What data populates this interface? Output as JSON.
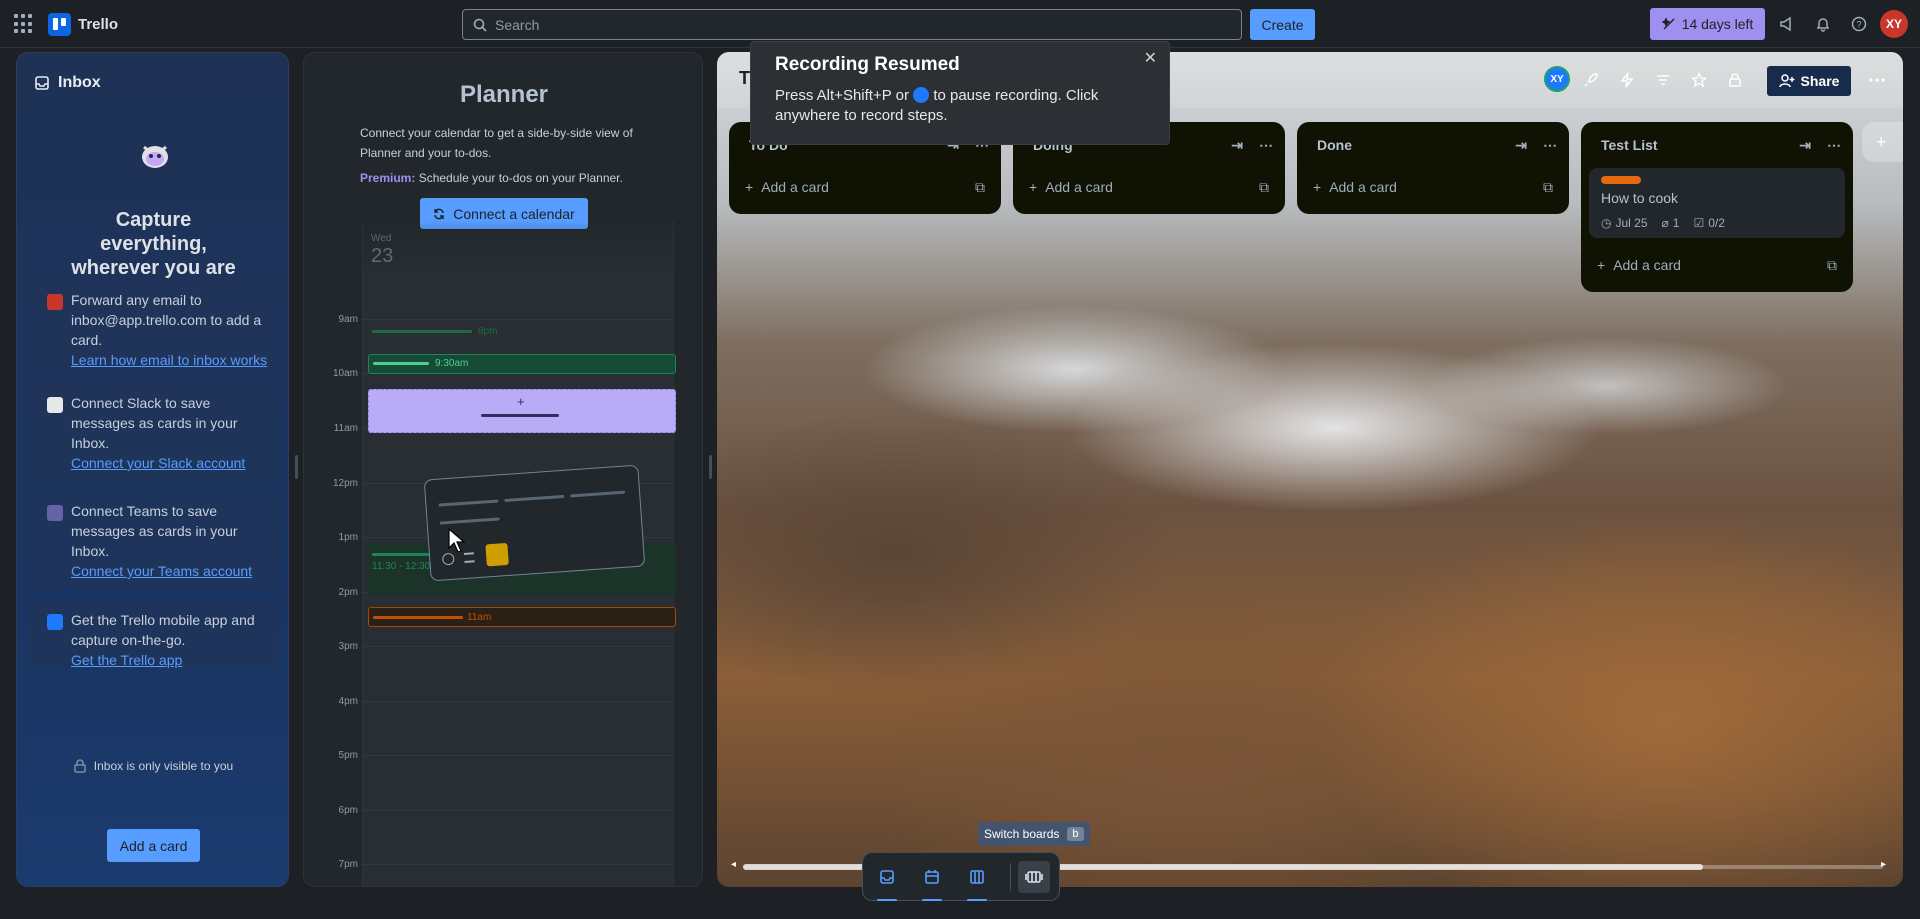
{
  "topbar": {
    "app_name": "Trello",
    "search_placeholder": "Search",
    "create_label": "Create",
    "trial_label": "14 days left",
    "avatar_initials": "XY"
  },
  "inbox": {
    "title": "Inbox",
    "headline": "Capture everything, wherever you are",
    "items": [
      {
        "icon": "email-icon",
        "text": "Forward any email to inbox@app.trello.com to add a card.",
        "link": "Learn how email to inbox works"
      },
      {
        "icon": "slack-icon",
        "text": "Connect Slack to save messages as cards in your Inbox.",
        "link": "Connect your Slack account"
      },
      {
        "icon": "teams-icon",
        "text": "Connect Teams to save messages as cards in your Inbox.",
        "link": "Connect your Teams account"
      },
      {
        "icon": "mobile-icon",
        "text": "Get the Trello mobile app and capture on-the-go.",
        "link": "Get the Trello app"
      }
    ],
    "private_note": "Inbox is only visible to you",
    "add_card_label": "Add a card"
  },
  "planner": {
    "title": "Planner",
    "description": "Connect your calendar to get a side-by-side view of Planner and your to-dos.",
    "premium_label": "Premium:",
    "premium_text": "Schedule your to-dos on your Planner.",
    "connect_label": "Connect a calendar",
    "day": "Wed",
    "date": "23",
    "hours": [
      "9am",
      "10am",
      "11am",
      "12pm",
      "1pm",
      "2pm",
      "3pm",
      "4pm",
      "5pm",
      "6pm",
      "7pm"
    ],
    "events": {
      "ev1_time": "8pm",
      "ev2_time": "9:30am",
      "ev3_time": "11:30 - 12:30pm",
      "ev4_time": "11am"
    }
  },
  "board": {
    "name": "Trello",
    "share_label": "Share",
    "avatar_initials": "XY",
    "lists": [
      {
        "name": "To Do",
        "add_label": "Add a card"
      },
      {
        "name": "Doing",
        "add_label": "Add a card"
      },
      {
        "name": "Done",
        "add_label": "Add a card"
      },
      {
        "name": "Test List",
        "add_label": "Add a card",
        "card": {
          "title": "How to cook",
          "due": "Jul 25",
          "attachments": "1",
          "checklist": "0/2"
        }
      }
    ]
  },
  "toast": {
    "title": "Recording Resumed",
    "body_pre": "Press Alt+Shift+P or",
    "body_post": "to pause recording. Click anywhere to record steps."
  },
  "switcher": {
    "tooltip": "Switch boards",
    "tooltip_key": "b"
  },
  "colors": {
    "accent": "#579dff",
    "trial": "#9f8fef",
    "label_orange": "#e56910"
  }
}
